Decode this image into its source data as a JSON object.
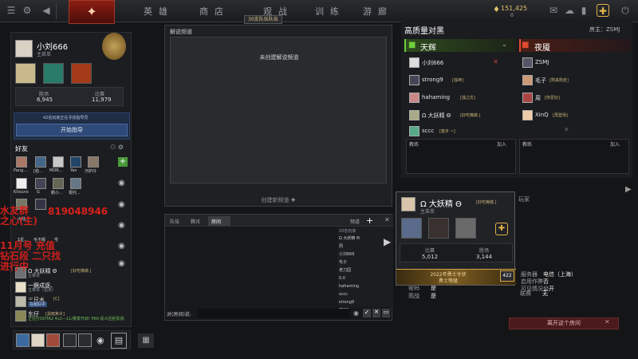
{
  "topnav": {
    "items": [
      "英雄",
      "商店",
      "观战",
      "训练",
      "游廊"
    ],
    "party_badge": "30支队伍队伍",
    "coins": "151,425",
    "coins_sub": "0"
  },
  "profile": {
    "name": "小刘666",
    "status": "主菜单",
    "stat1_label": "胜场",
    "stat1_value": "6,945",
    "stat2_label": "比赛",
    "stat2_value": "11,979"
  },
  "coach": {
    "text": "42名玩家正在寻找指导员",
    "button": "开始指导"
  },
  "friends": {
    "title": "好友",
    "top_names": [
      "Pang...",
      "[稳...",
      "MOR...",
      "Yan",
      "河护仔"
    ],
    "row2_names": [
      "Kitsune",
      "G",
      "鹏小...",
      "银托..."
    ],
    "list": [
      {
        "name": "Ω 大妖精 Θ",
        "tag": "[好吃懒做.]",
        "status": "主菜单"
      },
      {
        "name": "一蹶成逐、",
        "tag": "",
        "status": "主菜单（伯克）"
      },
      {
        "name": "三尺水",
        "tag": "[C]",
        "status": "在组队中"
      },
      {
        "name": "东仔",
        "tag": "[黑暗焦炎]",
        "status": "正在打DOTA2 4v2—11/赛季开启! P60·民众回拒影视"
      }
    ],
    "partial": [
      "大陆...",
      "Σ星...",
      "毛不暇",
      "宅"
    ]
  },
  "watermark": {
    "lines": [
      "水友群",
      "之心(主)",
      "11月号 充值",
      "钻石段 二只找",
      "进行中"
    ],
    "qq": "819048946"
  },
  "center": {
    "title": "解说频道",
    "empty": "未创建解说频道",
    "create": "创建新频道"
  },
  "chat": {
    "tabs": [
      "队伍",
      "腾讯",
      "房间"
    ],
    "channel_label": "频道",
    "input_label": "对(房间)说:",
    "members_header": "10名玩家",
    "members": [
      "Ω 大妖精 Θ",
      "周",
      "小刘666",
      "毛子",
      "老刀园",
      "0.0",
      "hahaming",
      "sccc",
      "strong9",
      "ZSMJ"
    ]
  },
  "lobby": {
    "title": "高质量对黑",
    "host": "房主：ZSMJ",
    "radiant": "天辉",
    "dire": "夜魇",
    "radiant_players": [
      {
        "name": "小刘666",
        "tag": "",
        "kick": "✕"
      },
      {
        "name": "strong9",
        "tag": "[独神]"
      },
      {
        "name": "hahaming",
        "tag": "[独之优]"
      },
      {
        "name": "Ω 大妖精 Θ",
        "tag": "[好吃懒做.]"
      },
      {
        "name": "sccc",
        "tag": "[废步 ~]"
      }
    ],
    "dire_players": [
      {
        "name": "ZSMJ",
        "tag": ""
      },
      {
        "name": "毛子",
        "tag": "[刚来刚走]"
      },
      {
        "name": "周",
        "tag": "[恢爱好]"
      },
      {
        "name": "XinQ",
        "tag": "[再登场]"
      },
      {
        "name": "",
        "tag": ""
      }
    ],
    "coach_label": "教练",
    "join_label": "加入",
    "unassigned": "玩家"
  },
  "popup": {
    "name": "Ω 大妖精 Θ",
    "tag": "[好吃懒做.]",
    "status": "主菜单",
    "stat1_label": "比赛",
    "stat1_value": "5,012",
    "stat2_label": "胜场",
    "stat2_value": "3,144",
    "badge": "2022年勇士令状",
    "badge_sub": "勇士等级",
    "level": "422"
  },
  "lobby_info": {
    "rows": [
      [
        "服务器",
        "电信（上海）"
      ],
      [
        "启用作弊",
        "否"
      ],
      [
        "可见情况",
        "公开"
      ],
      [
        "密码",
        "是"
      ],
      [
        "观战",
        "是"
      ],
      [
        "联赛",
        "无"
      ]
    ]
  },
  "leave_button": "离开这个房间",
  "colors": {
    "accent": "#d4a64a",
    "radiant": "#6fcf3c",
    "dire": "#e0492e",
    "leave": "#4a1a1c"
  }
}
